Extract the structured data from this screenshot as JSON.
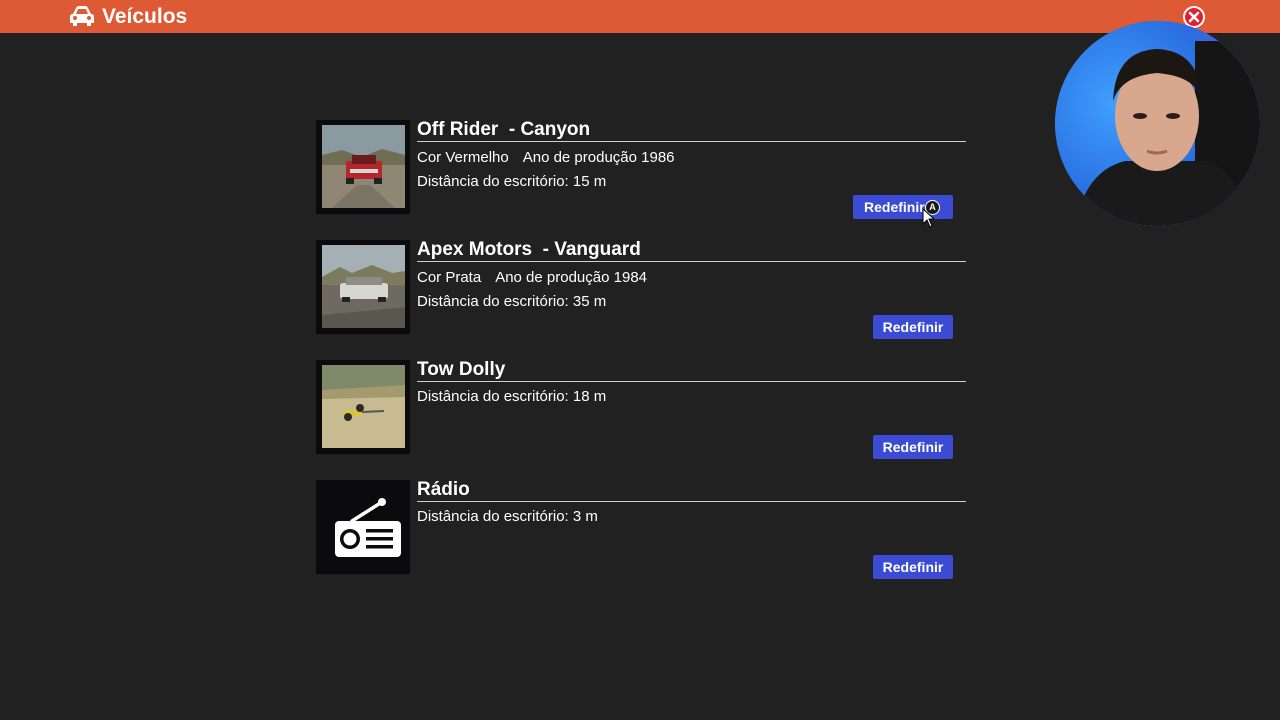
{
  "header": {
    "title": "Veículos",
    "icon": "car-icon",
    "close_icon": "close-icon",
    "bar_color": "#dd5a34"
  },
  "vehicles": [
    {
      "name": "Off Rider  - Canyon",
      "color": "Cor Vermelho",
      "year": "Ano de produção 1986",
      "distance": "Distância do escritório: 15 m",
      "button": "Redefinir",
      "button_hint": "A",
      "thumbnail": "red-truck-photo"
    },
    {
      "name": "Apex Motors  - Vanguard",
      "color": "Cor Prata",
      "year": "Ano de produção 1984",
      "distance": "Distância do escritório: 35 m",
      "button": "Redefinir",
      "thumbnail": "silver-car-photo"
    },
    {
      "name": "Tow Dolly",
      "distance": "Distância do escritório: 18 m",
      "button": "Redefinir",
      "thumbnail": "tow-dolly-photo"
    },
    {
      "name": "Rádio",
      "distance": "Distância do escritório: 3 m",
      "button": "Redefinir",
      "thumbnail": "radio-icon"
    }
  ],
  "colors": {
    "background": "#212121",
    "button": "#3b4bd3",
    "close": "#e02230"
  }
}
